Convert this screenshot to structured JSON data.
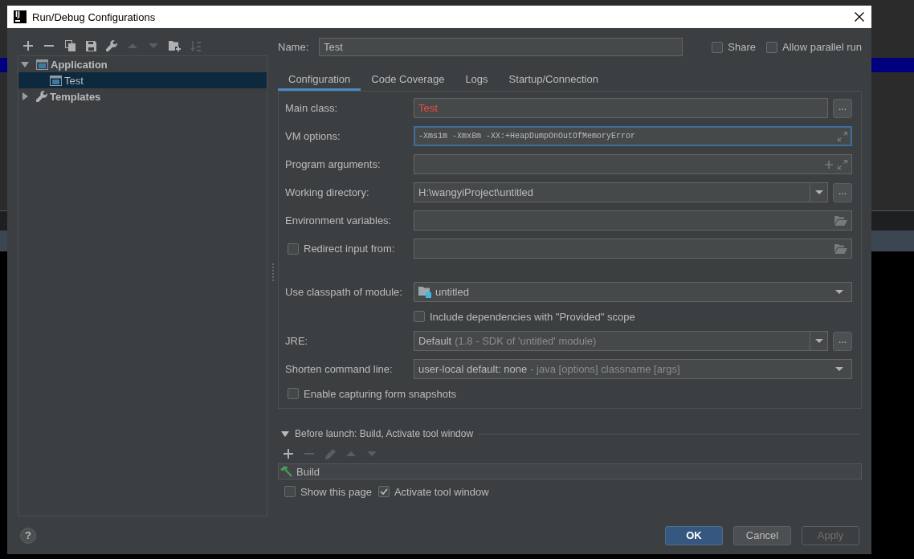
{
  "window": {
    "logo": "IJ",
    "title": "Run/Debug Configurations"
  },
  "sidebar": {
    "toolbar": [
      {
        "kind": "add",
        "disabled": false
      },
      {
        "kind": "remove",
        "disabled": false
      },
      {
        "kind": "copy",
        "disabled": false
      },
      {
        "kind": "save",
        "disabled": false
      },
      {
        "kind": "edit_templates",
        "disabled": false
      },
      {
        "kind": "move_up",
        "disabled": true
      },
      {
        "kind": "move_down",
        "disabled": true
      },
      {
        "kind": "new_folder",
        "disabled": false
      },
      {
        "kind": "sort",
        "disabled": true
      }
    ],
    "tree": [
      {
        "kind": "application",
        "label": "Application",
        "expanded": true,
        "selected": false,
        "children": [
          {
            "kind": "configuration",
            "label": "Test",
            "selected": true
          }
        ]
      },
      {
        "kind": "templates",
        "label": "Templates",
        "expanded": false,
        "selected": false
      }
    ]
  },
  "name": {
    "label": "Name:",
    "value": "Test"
  },
  "options": [
    {
      "label": "Share",
      "checked": false
    },
    {
      "label": "Allow parallel run",
      "checked": false
    }
  ],
  "tabs": [
    {
      "label": "Configuration",
      "selected": true
    },
    {
      "label": "Code Coverage",
      "selected": false
    },
    {
      "label": "Logs",
      "selected": false
    },
    {
      "label": "Startup/Connection",
      "selected": false
    }
  ],
  "form": {
    "rows": [
      {
        "kind": "text",
        "label": "Main class:",
        "value": "Test",
        "invalid": true,
        "focused": false,
        "button": "..."
      },
      {
        "kind": "expandable",
        "label": "VM options:",
        "value": "-Xms1m -Xmx8m -XX:+HeapDumpOnOutOfMemoryError",
        "invalid": false,
        "focused": true
      },
      {
        "kind": "arguments",
        "label": "Program arguments:",
        "focused": false
      },
      {
        "kind": "combo",
        "label": "Working directory:",
        "value": "H:\\wangyiProject\\untitled",
        "button": "..."
      },
      {
        "kind": "path",
        "label": "Environment variables:",
        "focused": false
      },
      {
        "kind": "path",
        "label": "Redirect input from:",
        "checked": false,
        "focused": false
      },
      {
        "kind": "module",
        "label": "Use classpath of module:",
        "value": "untitled"
      },
      {
        "kind": "checkbox",
        "label": "Include dependencies with \"Provided\" scope",
        "checked": false
      },
      {
        "kind": "combo",
        "label": "JRE:",
        "value": "Default",
        "hint": "(1.8 - SDK of 'untitled' module)",
        "button": "..."
      },
      {
        "kind": "dropdown",
        "label": "Shorten command line:",
        "value": "user-local default: none",
        "hint": "- java [options] classname [args]"
      },
      {
        "kind": "option",
        "label": "Enable capturing form snapshots",
        "checked": false
      }
    ]
  },
  "before_launch": {
    "title": "Before launch: Build, Activate tool window",
    "expanded": true,
    "toolbar": [
      {
        "kind": "add",
        "disabled": false
      },
      {
        "kind": "remove",
        "disabled": true
      },
      {
        "kind": "edit",
        "disabled": true
      },
      {
        "kind": "move_up",
        "disabled": true
      },
      {
        "kind": "move_down",
        "disabled": true
      }
    ],
    "tasks": [
      {
        "label": "Build"
      }
    ],
    "options": [
      {
        "label": "Show this page",
        "checked": false
      },
      {
        "label": "Activate tool window",
        "checked": true
      }
    ]
  },
  "footer": {
    "help_button": "?",
    "buttons": [
      {
        "label": "OK",
        "default": true,
        "disabled": false
      },
      {
        "label": "Cancel",
        "default": false,
        "disabled": false
      },
      {
        "label": "Apply",
        "default": false,
        "disabled": true
      }
    ]
  }
}
